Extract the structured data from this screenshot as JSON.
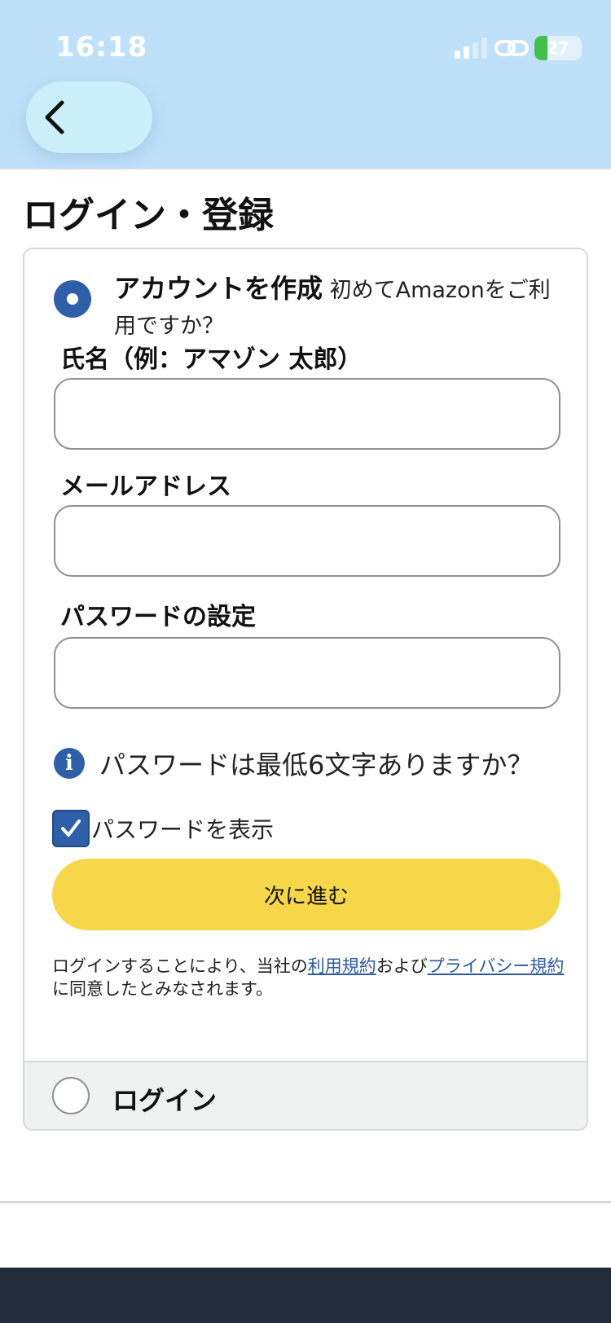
{
  "status_bar": {
    "time": "16:18",
    "battery": "27",
    "battery_level": 0.27
  },
  "page": {
    "title": "ログイン・登録"
  },
  "create_account": {
    "heading": "アカウントを作成",
    "subtext": " 初めてAmazonをご利用ですか？",
    "name_label": "氏名（例：アマゾン 太郎）",
    "name_value": "",
    "email_label": "メールアドレス",
    "email_value": "",
    "password_label": "パスワードの設定",
    "password_value": "",
    "password_hint": "パスワードは最低6文字ありますか？",
    "show_password_label": "パスワードを表示",
    "show_password_checked": true,
    "continue_label": "次に進む",
    "legal_prefix": "ログインすることにより、当社の",
    "terms_link": "利用規約",
    "legal_and": "および",
    "privacy_link": "プライバシー規約",
    "legal_suffix": "に同意したとみなされます。"
  },
  "login_option": {
    "label": "ログイン"
  },
  "icons": {
    "back": "chevron-left-icon",
    "signal": "signal-icon",
    "link": "link-icon",
    "battery": "battery-icon",
    "info": "info-icon",
    "check": "checkmark-icon"
  },
  "colors": {
    "header_bg": "#bfe0f9",
    "accent_blue": "#2f5fa8",
    "button_yellow": "#f7d74a",
    "link_blue": "#2c5aa0",
    "footer_bg": "#222b3a"
  }
}
